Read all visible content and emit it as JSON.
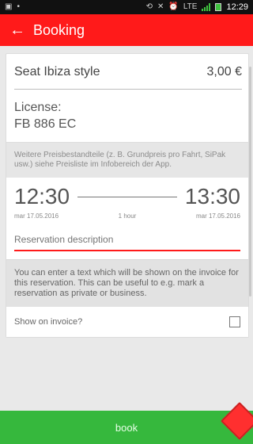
{
  "status_bar": {
    "time": "12:29"
  },
  "app_bar": {
    "title": "Booking",
    "back_icon": "arrow-left-icon"
  },
  "booking": {
    "car_name": "Seat Ibiza style",
    "price": "3,00 €",
    "license_label": "License:",
    "license_value": "FB 886 EC",
    "price_notice": "Weitere Preisbestandteile (z. B. Grundpreis pro Fahrt, SiPak usw.) siehe Preisliste im Infobereich der App.",
    "start_time": "12:30",
    "end_time": "13:30",
    "start_date": "mar 17.05.2016",
    "end_date": "mar 17.05.2016",
    "duration": "1 hour",
    "reservation_description": {
      "label": "Reservation description",
      "value": ""
    },
    "description_help": "You can enter a text which will be shown on the invoice for this reservation. This can be useful to e.g. mark a reservation as private or business.",
    "partial_row_label": "Show on invoice?"
  },
  "actions": {
    "book_label": "book"
  },
  "colors": {
    "accent_red": "#ff1a1a",
    "book_green": "#36b83d"
  }
}
